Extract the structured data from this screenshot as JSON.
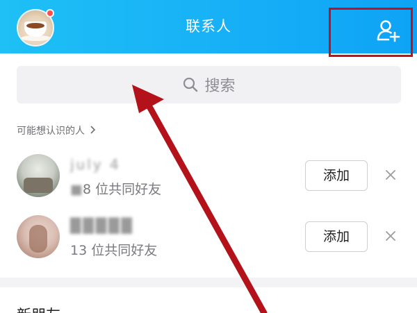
{
  "header": {
    "title": "联系人",
    "accent_color": "#17b0f7",
    "avatar_icon": "coffee-cup-avatar",
    "add_contact_icon": "add-user-icon",
    "highlight_color": "#c3101a"
  },
  "search": {
    "placeholder": "搜索",
    "icon": "search-icon"
  },
  "suggestions": {
    "section_label": "可能想认识的人",
    "chevron_icon": "chevron-right-icon",
    "people": [
      {
        "name": "july 4",
        "mutual_count": "8",
        "mutual_text": " 位共同好友",
        "add_label": "添加"
      },
      {
        "name": "",
        "mutual_count": "13",
        "mutual_text": " 位共同好友",
        "add_label": "添加"
      }
    ]
  },
  "list": {
    "new_friends_label": "新朋友"
  },
  "annotation": {
    "arrow_color": "#b3121a"
  }
}
